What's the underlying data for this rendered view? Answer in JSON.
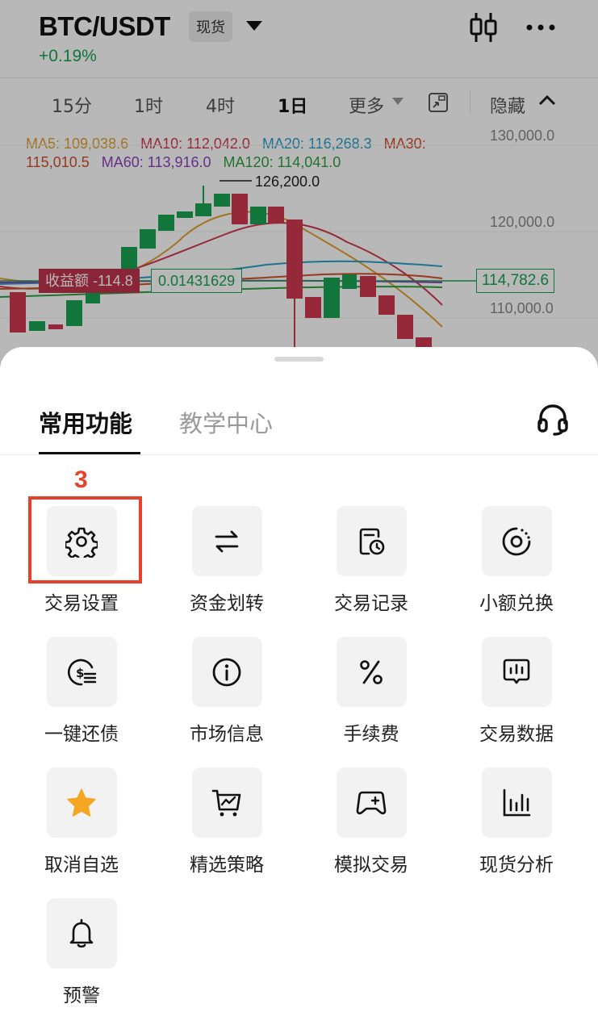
{
  "header": {
    "pair": "BTC/USDT",
    "market_tag": "现货",
    "change": "+0.19%"
  },
  "timeframes": {
    "items": [
      "15分",
      "1时",
      "4时",
      "1日",
      "更多"
    ],
    "active": "1日",
    "hide_label": "隐藏"
  },
  "chart": {
    "ma_row1": [
      {
        "text": "MA5: 109,038.6",
        "color": "#e0a030"
      },
      {
        "text": "MA10: 112,042.0",
        "color": "#d0394f"
      },
      {
        "text": "MA20: 116,268.3",
        "color": "#2aa0c8"
      },
      {
        "text": "MA30:",
        "color": "#d0502a"
      }
    ],
    "ma_row2": [
      {
        "text": "115,010.5",
        "color": "#d0502a"
      },
      {
        "text": "MA60: 113,916.0",
        "color": "#9040c0"
      },
      {
        "text": "MA120: 114,041.0",
        "color": "#30a040"
      }
    ],
    "axis_labels": [
      "130,000.0",
      "120,000.0",
      "110,000.0"
    ],
    "peak_label": "126,200.0",
    "pnl_tag": "收益额 -114.8",
    "qty_tag": "0.01431629",
    "current_price": "114,782.6"
  },
  "sheet": {
    "tabs": [
      {
        "label": "常用功能",
        "active": true
      },
      {
        "label": "教学中心",
        "active": false
      }
    ],
    "step_marker": "3",
    "functions": [
      {
        "label": "交易设置",
        "icon": "gear-icon"
      },
      {
        "label": "资金划转",
        "icon": "transfer-icon"
      },
      {
        "label": "交易记录",
        "icon": "history-icon"
      },
      {
        "label": "小额兑换",
        "icon": "small-convert-icon"
      },
      {
        "label": "一键还债",
        "icon": "repay-icon"
      },
      {
        "label": "市场信息",
        "icon": "info-icon"
      },
      {
        "label": "手续费",
        "icon": "percent-icon"
      },
      {
        "label": "交易数据",
        "icon": "data-icon"
      },
      {
        "label": "取消自选",
        "icon": "star-icon"
      },
      {
        "label": "精选策略",
        "icon": "strategy-icon"
      },
      {
        "label": "模拟交易",
        "icon": "demo-trading-icon"
      },
      {
        "label": "现货分析",
        "icon": "analysis-icon"
      },
      {
        "label": "预警",
        "icon": "bell-icon"
      }
    ]
  },
  "colors": {
    "up": "#1aa352",
    "down": "#d0394f",
    "highlight": "#e8402b",
    "star": "#f5a623"
  }
}
